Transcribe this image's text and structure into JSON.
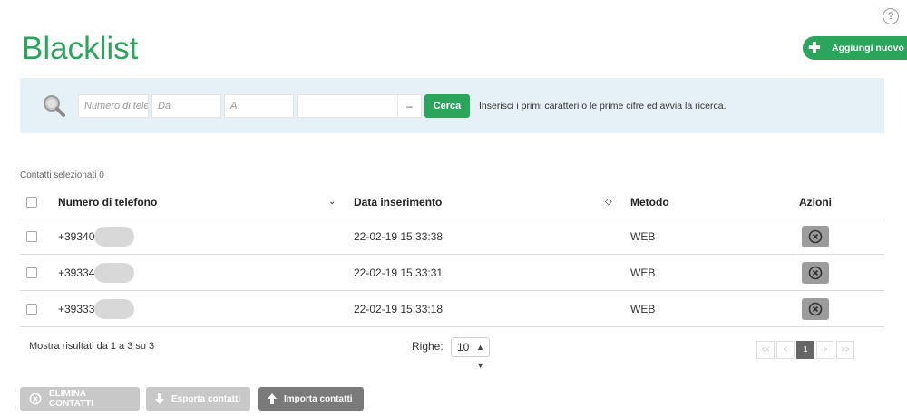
{
  "help": {
    "label": "?"
  },
  "page": {
    "title": "Blacklist"
  },
  "header": {
    "add_label": "Aggiungi nuovo"
  },
  "search": {
    "phone_placeholder": "Numero di telefono",
    "from_placeholder": "Da",
    "to_placeholder": "A",
    "method_value": "",
    "method_arrow": "–",
    "button_label": "Cerca",
    "hint": "Inserisci i primi caratteri o le prime cifre ed avvia la ricerca."
  },
  "selection": {
    "label": "Contatti selezionati 0"
  },
  "table": {
    "columns": [
      "Numero di telefono",
      "Data inserimento",
      "Metodo",
      "Azioni"
    ],
    "sort_numero": "⌄",
    "sort_data": "◇",
    "rows": [
      {
        "phone": "+39340",
        "date": "22-02-19 15:33:38",
        "method": "WEB"
      },
      {
        "phone": "+39334",
        "date": "22-02-19 15:33:31",
        "method": "WEB"
      },
      {
        "phone": "+39333",
        "date": "22-02-19 15:33:18",
        "method": "WEB"
      }
    ]
  },
  "footer": {
    "info": "Mostra risultati da 1 a 3 su 3",
    "rows_label": "Righe:",
    "rows_value": "10",
    "pager": {
      "first": "<<",
      "prev": "<",
      "current": "1",
      "next": ">",
      "last": ">>"
    }
  },
  "actions": {
    "delete_label": "ELIMINA CONTATTI",
    "export_label": "Esporta contatti",
    "import_label": "Importa contatti"
  },
  "colors": {
    "accent": "#2ba45c",
    "search_bg": "#e6f1f7",
    "disabled": "#c8c8c8",
    "dark_button": "#7a7a7a"
  }
}
